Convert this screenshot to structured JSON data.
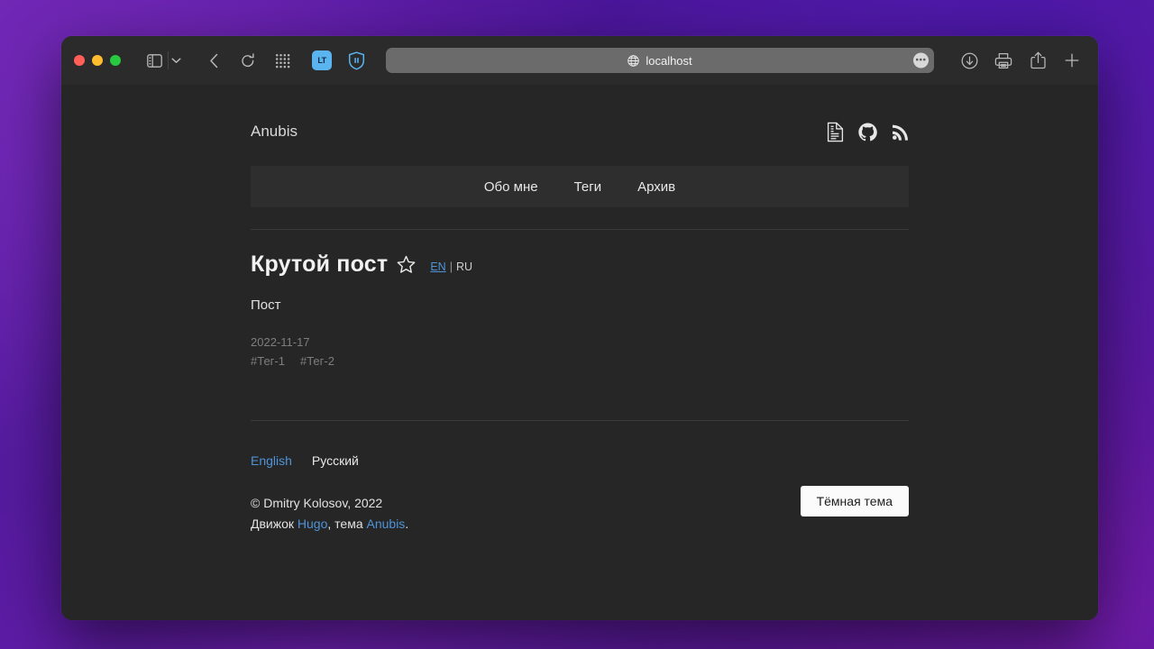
{
  "browser": {
    "url": "localhost",
    "url_icon": "globe-icon",
    "more_label": "•••",
    "toolbar_left": [
      {
        "name": "sidebar-toggle-button",
        "icon": "sidebar-icon"
      },
      {
        "name": "tab-overview-chevron",
        "icon": "chevron-down-icon"
      },
      {
        "name": "back-button",
        "icon": "chevron-left-icon"
      },
      {
        "name": "reload-button",
        "icon": "reload-icon"
      },
      {
        "name": "tab-grid-button",
        "icon": "grid-icon"
      },
      {
        "name": "languagetool-extension-button",
        "icon": "languagetool-icon",
        "label": "LT"
      },
      {
        "name": "adguard-extension-button",
        "icon": "adguard-shield-icon"
      }
    ],
    "toolbar_right": [
      {
        "name": "downloads-button",
        "icon": "download-icon"
      },
      {
        "name": "print-button",
        "icon": "printer-icon"
      },
      {
        "name": "share-button",
        "icon": "share-icon"
      },
      {
        "name": "new-tab-button",
        "icon": "plus-icon"
      }
    ],
    "accent_blue": "#5ab4f0"
  },
  "site": {
    "title": "Anubis",
    "header_icons": [
      {
        "name": "cv-icon",
        "title": "CV"
      },
      {
        "name": "github-icon",
        "title": "GitHub"
      },
      {
        "name": "rss-icon",
        "title": "RSS"
      }
    ],
    "nav": [
      {
        "label": "Обо мне"
      },
      {
        "label": "Теги"
      },
      {
        "label": "Архив"
      }
    ]
  },
  "post": {
    "title": "Крутой пост",
    "star_icon": "star-outline-icon",
    "lang_switch": {
      "en": "EN",
      "separator": "|",
      "ru": "RU"
    },
    "body": "Пост",
    "date": "2022-11-17",
    "tags": [
      "#Тег-1",
      "#Тег-2"
    ]
  },
  "footer": {
    "lang_links": [
      {
        "label": "English",
        "active": false
      },
      {
        "label": "Русский",
        "active": true
      }
    ],
    "copyright": "© Dmitry Kolosov, 2022",
    "engine_prefix": "Движок ",
    "engine_link": "Hugo",
    "engine_middle": ", тема ",
    "theme_link": "Anubis",
    "engine_suffix": ".",
    "theme_button": "Тёмная тема",
    "link_color": "#4f93d8"
  }
}
